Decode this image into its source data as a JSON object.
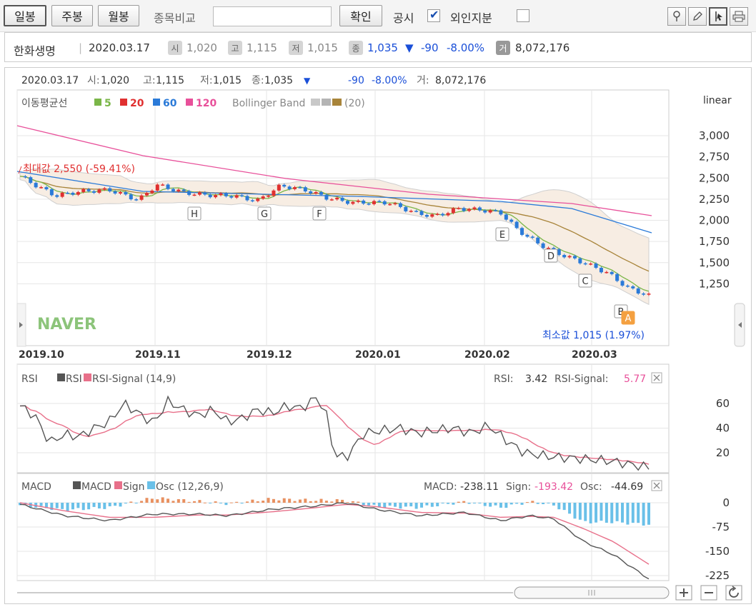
{
  "toolbar": {
    "period_buttons": [
      {
        "label": "일봉",
        "active": true
      },
      {
        "label": "주봉",
        "active": false
      },
      {
        "label": "월봉",
        "active": false
      }
    ],
    "compare_label": "종목비교",
    "compare_input_value": "",
    "confirm_label": "확인",
    "disclosure_label": "공시",
    "disclosure_checked": true,
    "foreign_label": "외인지분",
    "foreign_checked": false,
    "tools": [
      "pin-icon",
      "pencil-icon",
      "crosshair-icon",
      "print-icon"
    ]
  },
  "stock": {
    "name": "한화생명",
    "date": "2020.03.17",
    "open_badge": "시",
    "open": "1,020",
    "high_badge": "고",
    "high": "1,115",
    "low_badge": "저",
    "low": "1,015",
    "close_badge": "종",
    "close": "1,035",
    "change_arrow": "▼",
    "change": "-90",
    "change_pct": "-8.00%",
    "volume_badge": "거",
    "volume": "8,072,176"
  },
  "header_line": {
    "date": "2020.03.17",
    "open_label": "시:",
    "open": "1,020",
    "high_label": "고:",
    "high": "1,115",
    "low_label": "저:",
    "low": "1,015",
    "close_label": "종:",
    "close": "1,035",
    "arrow": "▼",
    "change": "-90",
    "change_pct": "-8.00%",
    "volume_label": "거:",
    "volume": "8,072,176"
  },
  "price_panel": {
    "scale_label": "linear",
    "ma_label": "이동평균선",
    "ma_periods": [
      {
        "label": "5",
        "color": "#7ab648"
      },
      {
        "label": "20",
        "color": "#e03030"
      },
      {
        "label": "60",
        "color": "#2a7ad8"
      },
      {
        "label": "120",
        "color": "#e8509a"
      }
    ],
    "bollinger_label": "Bollinger Band",
    "bollinger_period": "(20)",
    "max_label": "최대값 2,550 (-59.41%)",
    "min_label": "최소값 1,015 (1.97%)",
    "watermark": "NAVER",
    "y_ticks": [
      "3,000",
      "2,750",
      "2,500",
      "2,250",
      "2,000",
      "1,750",
      "1,500",
      "1,250"
    ],
    "x_ticks": [
      "2019.10",
      "2019.11",
      "2019.12",
      "2020.01",
      "2020.02",
      "2020.03"
    ],
    "markers": [
      "H",
      "G",
      "F",
      "E",
      "D",
      "C",
      "B",
      "A"
    ]
  },
  "rsi_panel": {
    "title": "RSI",
    "legend_rsi": "RSI",
    "legend_signal": "RSI-Signal (14,9)",
    "rsi_label": "RSI:",
    "rsi_value": "3.42",
    "signal_label": "RSI-Signal:",
    "signal_value": "5.77",
    "y_ticks": [
      "60",
      "40",
      "20"
    ]
  },
  "macd_panel": {
    "title": "MACD",
    "legend_macd": "MACD",
    "legend_sign": "Sign",
    "legend_osc": "Osc (12,26,9)",
    "macd_label": "MACD:",
    "macd_value": "-238.11",
    "sign_label": "Sign:",
    "sign_value": "-193.42",
    "osc_label": "Osc:",
    "osc_value": "-44.69",
    "y_ticks": [
      "0",
      "-75",
      "-150",
      "-225"
    ]
  },
  "colors": {
    "up": "#e03030",
    "down": "#2a7ad8",
    "rsi_line": "#555555",
    "signal_line": "#e8708a",
    "osc_pos": "#e89060",
    "osc_neg": "#6ac0e8"
  }
}
